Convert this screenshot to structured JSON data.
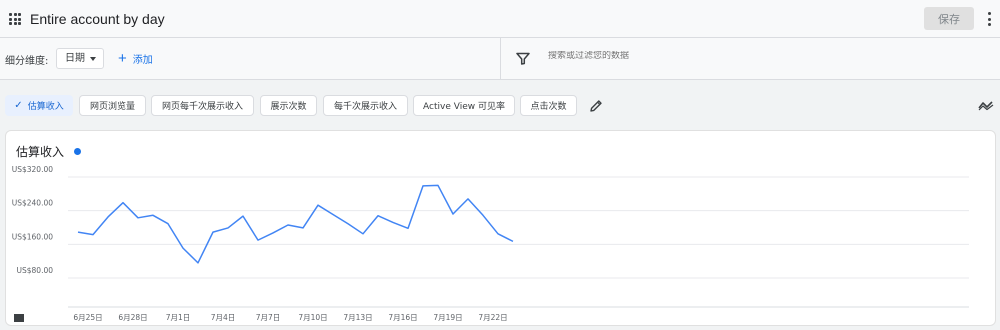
{
  "header": {
    "title": "Entire account by day",
    "save_label": "保存"
  },
  "filters": {
    "dimension_label": "细分维度:",
    "dimension_value": "日期",
    "add_label": "添加",
    "search_placeholder": "搜索或过滤您的数据"
  },
  "metrics": [
    {
      "label": "估算收入",
      "active": true
    },
    {
      "label": "网页浏览量",
      "active": false
    },
    {
      "label": "网页每千次展示收入",
      "active": false
    },
    {
      "label": "展示次数",
      "active": false
    },
    {
      "label": "每千次展示收入",
      "active": false
    },
    {
      "label": "Active View 可见率",
      "active": false
    },
    {
      "label": "点击次数",
      "active": false
    }
  ],
  "colors": {
    "accent": "#1a73e8",
    "line": "#4285f4"
  },
  "chart_data": {
    "type": "line",
    "title": "估算收入",
    "x": [
      "6月24日",
      "6月25日",
      "6月26日",
      "6月27日",
      "6月28日",
      "6月29日",
      "6月30日",
      "7月1日",
      "7月2日",
      "7月3日",
      "7月4日",
      "7月5日",
      "7月6日",
      "7月7日",
      "7月8日",
      "7月9日",
      "7月10日",
      "7月11日",
      "7月12日",
      "7月13日",
      "7月14日",
      "7月15日",
      "7月16日",
      "7月17日",
      "7月18日",
      "7月19日",
      "7月20日",
      "7月21日",
      "7月22日",
      "7月23日",
      "7月24日"
    ],
    "x_tick_labels": [
      "6月25日",
      "6月28日",
      "7月1日",
      "7月4日",
      "7月7日",
      "7月10日",
      "7月13日",
      "7月16日",
      "7月19日",
      "7月22日"
    ],
    "series": [
      {
        "values": [
          189,
          183,
          225,
          259,
          223,
          229,
          209,
          151,
          116,
          189,
          199,
          227,
          170,
          187,
          206,
          199,
          253,
          231,
          209,
          185,
          228,
          212,
          198,
          299,
          300,
          232,
          268,
          229,
          185,
          167
        ]
      }
    ],
    "y_tick_labels": [
      "US$80.00",
      "US$160.00",
      "US$240.00",
      "US$320.00"
    ],
    "ylim": [
      80,
      320
    ],
    "grid": true
  }
}
